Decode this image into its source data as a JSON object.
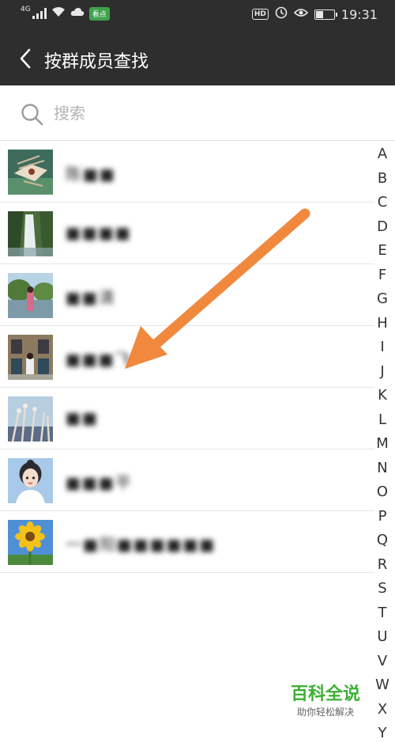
{
  "status_bar": {
    "network": "4G",
    "app_badge": "看点",
    "hd": "HD",
    "time": "19:31"
  },
  "header": {
    "title": "按群成员查找",
    "back_icon": "chevron-left-icon"
  },
  "search": {
    "placeholder": "搜索",
    "value": ""
  },
  "members": [
    {
      "name": "陈■■",
      "avatar": "lionfish"
    },
    {
      "name": "■■■■",
      "avatar": "waterfall"
    },
    {
      "name": "■■清",
      "avatar": "lakeside-person"
    },
    {
      "name": "■■■飞",
      "avatar": "building-person"
    },
    {
      "name": "■■",
      "avatar": "reeds"
    },
    {
      "name": "■■■平",
      "avatar": "cartoon-girl"
    },
    {
      "name": "一■阳■■■■■■",
      "avatar": "sunflower"
    }
  ],
  "index_letters": [
    "A",
    "B",
    "C",
    "D",
    "E",
    "F",
    "G",
    "H",
    "I",
    "J",
    "K",
    "L",
    "M",
    "N",
    "O",
    "P",
    "Q",
    "R",
    "S",
    "T",
    "U",
    "V",
    "W",
    "X",
    "Y"
  ],
  "watermark": {
    "title": "百科全说",
    "subtitle": "助你轻松解决"
  },
  "colors": {
    "header_bg": "#2e2e2e",
    "arrow": "#f0883e",
    "watermark_green": "#3cb034"
  }
}
